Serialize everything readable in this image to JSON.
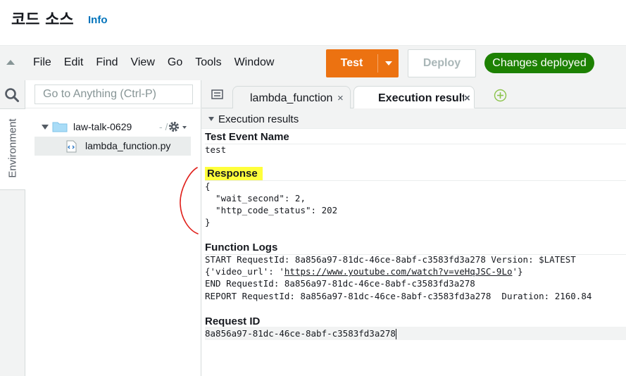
{
  "header": {
    "title": "코드 소스",
    "info_link": "Info"
  },
  "toolbar": {
    "menu": [
      "File",
      "Edit",
      "Find",
      "View",
      "Go",
      "Tools",
      "Window"
    ],
    "test_label": "Test",
    "deploy_label": "Deploy",
    "status_badge": "Changes deployed",
    "colors": {
      "test": "#ec7211",
      "status": "#1d8102"
    }
  },
  "rail": {
    "environment_label": "Environment"
  },
  "file_panel": {
    "goto_placeholder": "Go to Anything (Ctrl-P)",
    "folder_name": "law-talk-0629",
    "folder_path": "- /",
    "file_name": "lambda_function.py"
  },
  "tabs": [
    {
      "label": "lambda_function",
      "close": "×"
    },
    {
      "label": "Execution results",
      "close": "×"
    }
  ],
  "results": {
    "title": "Execution results",
    "test_event_label": "Test Event Name",
    "test_event_value": "test",
    "response_label": "Response",
    "response_lines": [
      "{",
      "  \"wait_second\": 2,",
      "  \"http_code_status\": 202",
      "}"
    ],
    "logs_label": "Function Logs",
    "log_start": "START RequestId: 8a856a97-81dc-46ce-8abf-c3583fd3a278 Version: $LATEST",
    "log_video_prefix": "{'video_url': '",
    "log_video_link": "https://www.youtube.com/watch?v=veHqJSC-9Lo",
    "log_video_suffix": "'}",
    "log_end": "END RequestId: 8a856a97-81dc-46ce-8abf-c3583fd3a278",
    "log_report": "REPORT RequestId: 8a856a97-81dc-46ce-8abf-c3583fd3a278  Duration: 2160.84",
    "request_id_label": "Request ID",
    "request_id_value": "8a856a97-81dc-46ce-8abf-c3583fd3a278"
  }
}
